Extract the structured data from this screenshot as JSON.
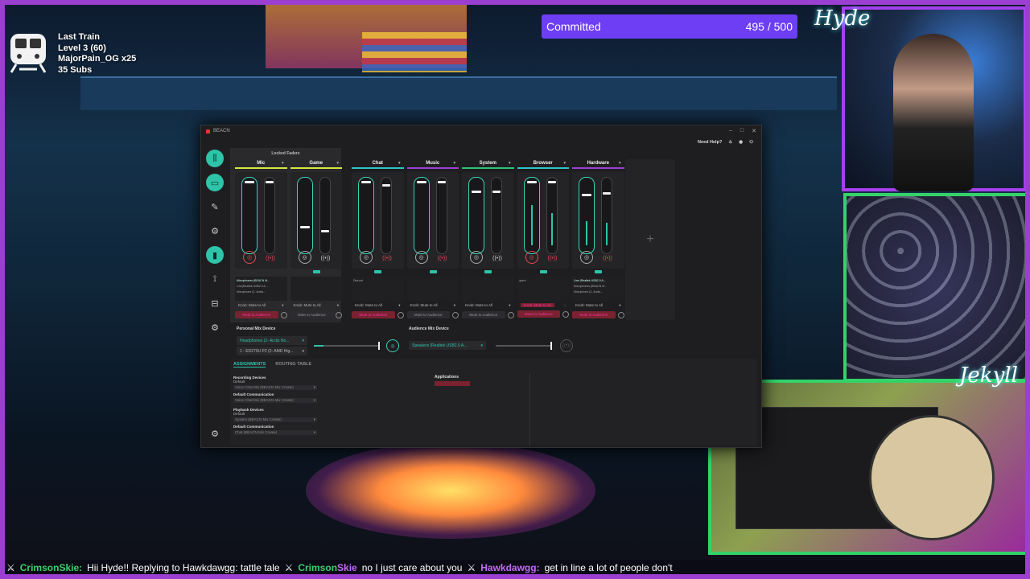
{
  "train": {
    "title": "Last Train",
    "level": "Level 3  (60)",
    "conductor": "MajorPain_OG x25",
    "subs": "35 Subs"
  },
  "goal": {
    "label": "Committed",
    "count": "495 / 500",
    "color": "#6d3ef3"
  },
  "cams": {
    "top_name": "Hyde",
    "bottom_name": "Jekyll"
  },
  "beacn": {
    "title": "BEACN",
    "need_help": "Need Help?",
    "locked_faders": "Locked Faders",
    "channels": [
      {
        "name": "Mic",
        "color": "#d4e83a",
        "list": [
          "Microphones (BEACN M...",
          "Line(Realtek USB2.0 A...",
          "Microphone (2- Arctis..."
        ],
        "control": "Knob: Mute to All",
        "mute": "Mute to Audience",
        "mute_red": true
      },
      {
        "name": "Game",
        "color": "#d4e83a",
        "list": [],
        "control": "Knob: Mute to All",
        "mute": "Mute to Audience",
        "mute_red": false
      },
      {
        "name": "Chat",
        "color": "#2ec4c9",
        "list": [
          "Discord"
        ],
        "control": "Knob: Mute to All",
        "mute": "Mute to Audience",
        "mute_red": true
      },
      {
        "name": "Music",
        "color": "#9b3fd1",
        "list": [],
        "control": "Knob: Mute to All",
        "mute": "Mute to Audience",
        "mute_red": false
      },
      {
        "name": "System",
        "color": "#2ec477",
        "list": [],
        "control": "Knob: Mute to All",
        "mute": "Mute to Audience",
        "mute_red": false
      },
      {
        "name": "Browser",
        "color": "#2ec4c9",
        "list": [
          "opera"
        ],
        "control": "Knob: Mute to All",
        "mute": "Mute to Audience",
        "mute_red": true
      },
      {
        "name": "Hardware",
        "color": "#9b3fd1",
        "list": [
          "Line (Realtek USB2.0 A...",
          "Microphones (BEACN M...",
          "Microphone (2- Arctis..."
        ],
        "control": "Knob: Mute to All",
        "mute": "Mute to Audience",
        "mute_red": true
      }
    ],
    "personal_mix": {
      "label": "Personal Mix Device",
      "device": "Headphones (2- Arctis No...",
      "device2": "1 - ED270U P2 (2- AMD Hig..."
    },
    "audience_mix": {
      "label": "Audience Mix Device",
      "device": "Speakers (Realtek USB2.0 A..."
    },
    "tabs": [
      "ASSIGNMENTS",
      "ROUTING TABLE"
    ],
    "assignments": {
      "recording": "Recording Devices",
      "default": "Default",
      "default_comm": "Default Communication",
      "rec_default_val": "Voice Chat Mix (BEACN Mix Create)",
      "rec_comm_val": "Voice Chat Mix (BEACN Mix Create)",
      "playback": "Playback Devices",
      "pb_default_val": "System (BEACN Mix Create)",
      "pb_comm_val": "Chat (BEACN Mix Create)",
      "applications": "Applications"
    }
  },
  "chat": {
    "user1": "CrimsonSkie:",
    "msg1": "Hii Hyde!!  Replying to Hawkdawgg: tattle tale",
    "user2": "Crimson",
    "user2b": "Skie",
    "msg2": "no I just care about you",
    "user3": "Hawkdawgg:",
    "msg3": "get in line a lot of people don't"
  }
}
